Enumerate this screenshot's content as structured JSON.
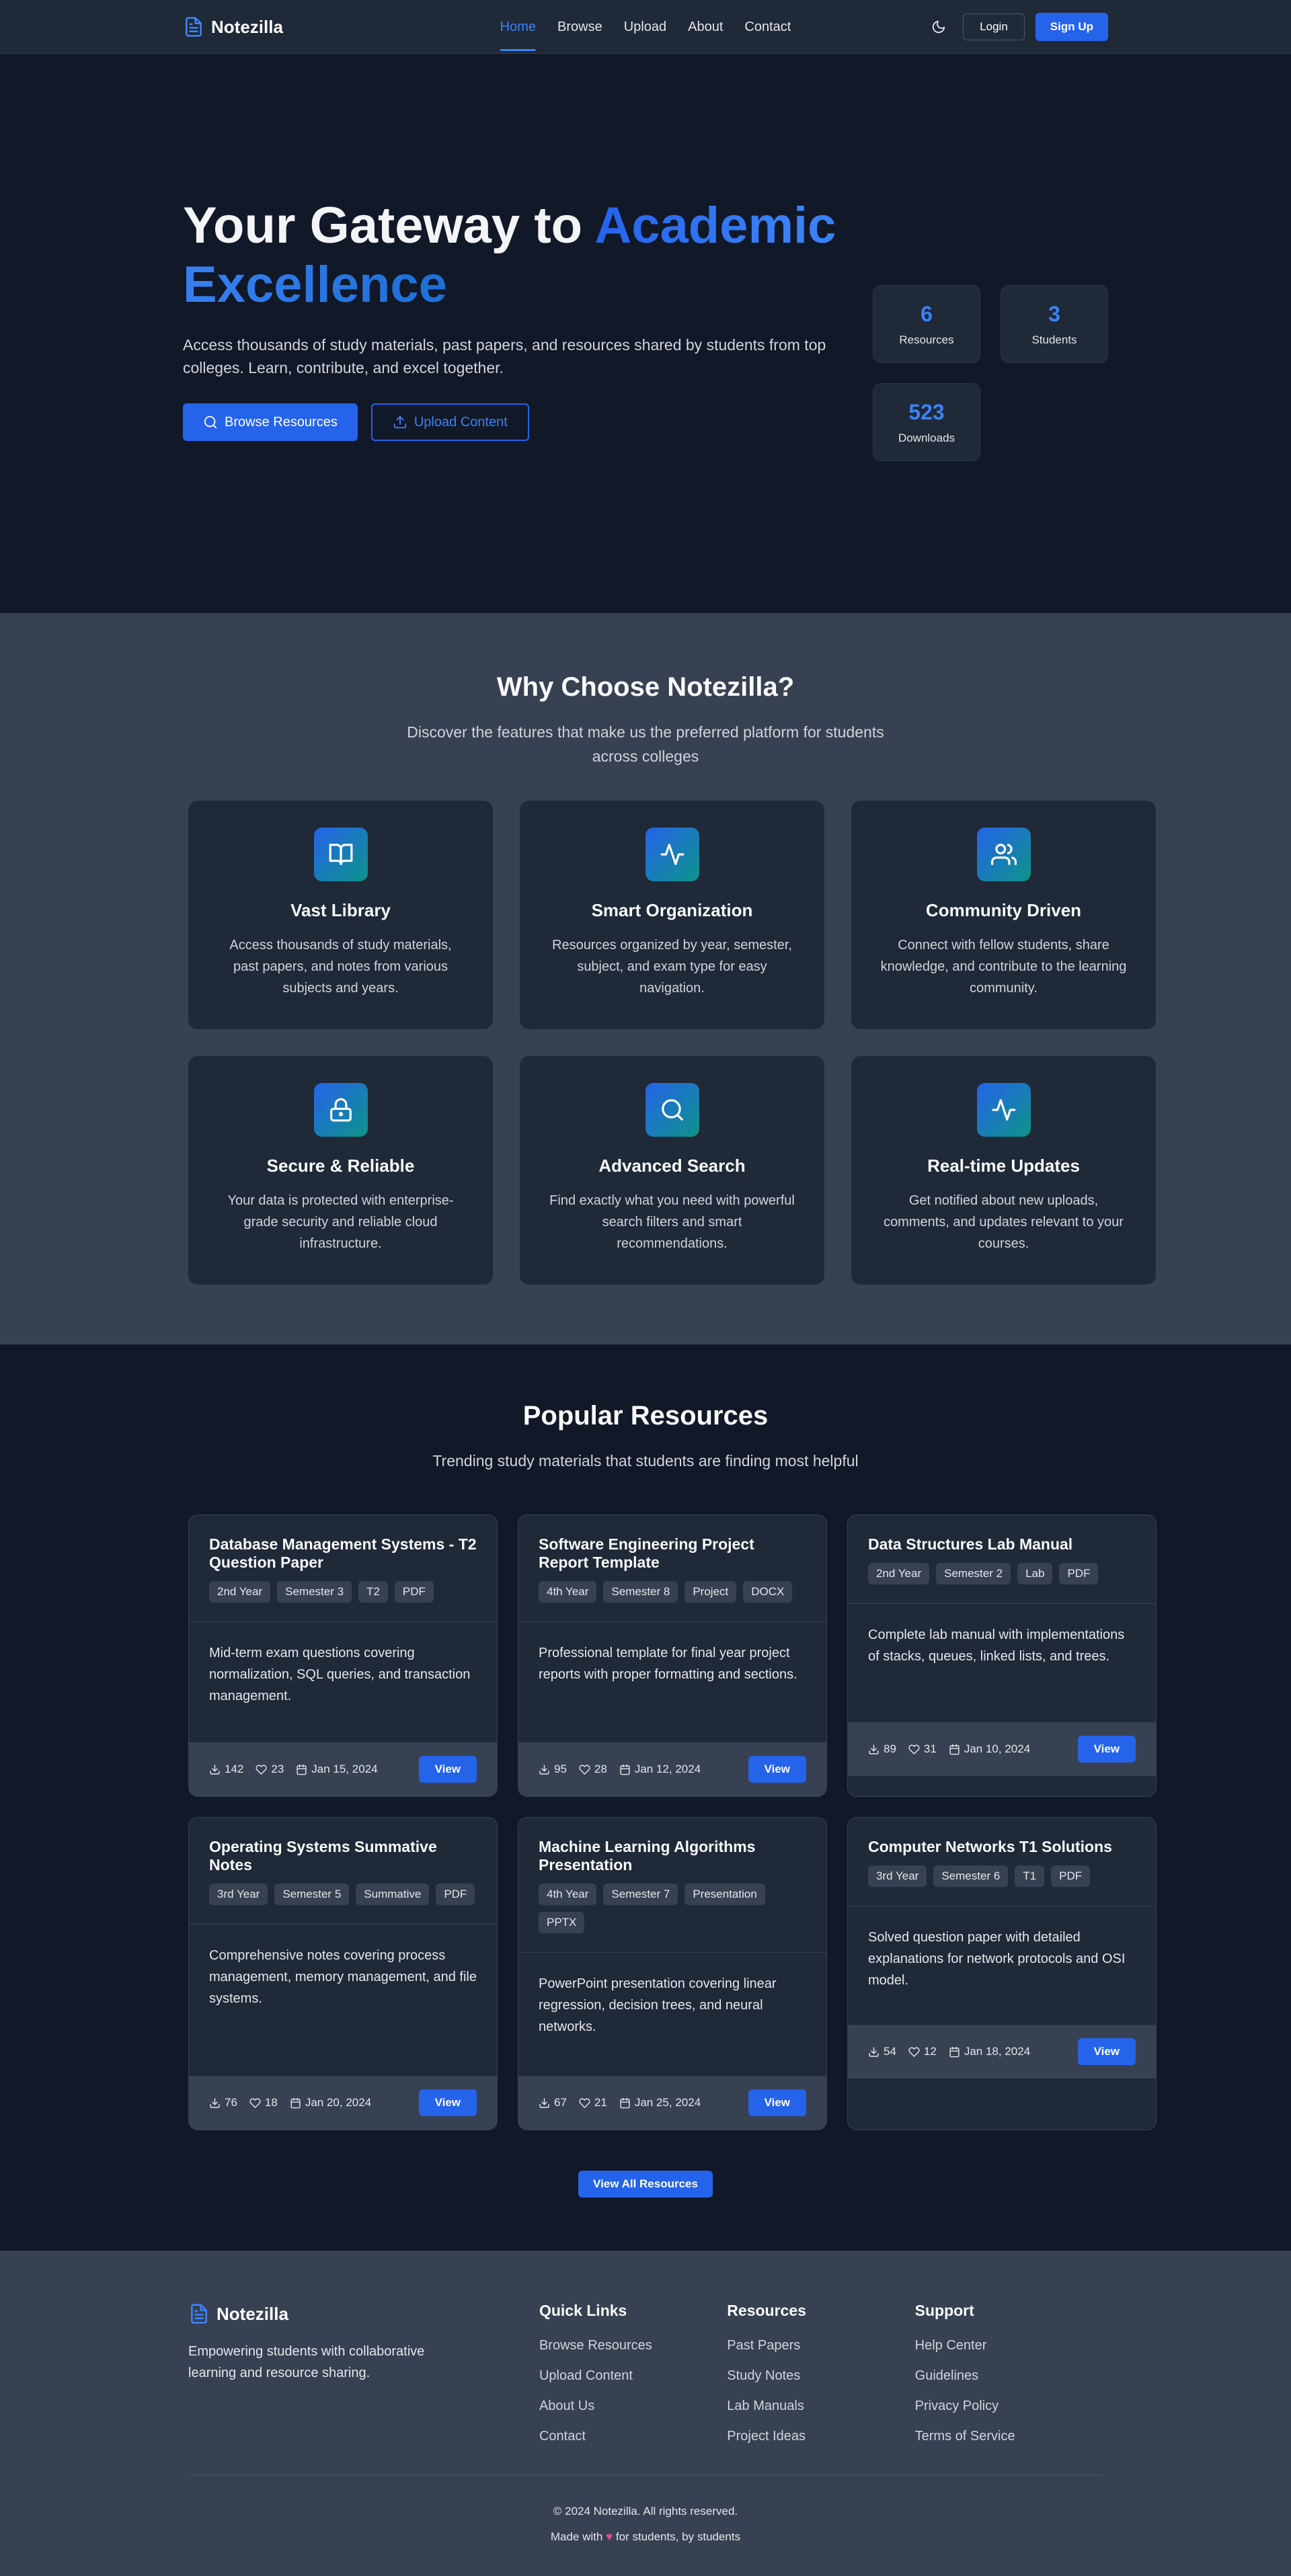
{
  "brand": {
    "name": "Notezilla"
  },
  "nav": {
    "links": [
      {
        "label": "Home",
        "active": true
      },
      {
        "label": "Browse"
      },
      {
        "label": "Upload"
      },
      {
        "label": "About"
      },
      {
        "label": "Contact"
      }
    ],
    "login": "Login",
    "signup": "Sign Up"
  },
  "hero": {
    "title_prefix": "Your Gateway to ",
    "title_accent": "Academic Excellence",
    "description": "Access thousands of study materials, past papers, and resources shared by students from top colleges. Learn, contribute, and excel together.",
    "browse_btn": "Browse Resources",
    "upload_btn": "Upload Content",
    "stats": [
      {
        "value": "6",
        "label": "Resources"
      },
      {
        "value": "3",
        "label": "Students"
      },
      {
        "value": "523",
        "label": "Downloads"
      }
    ]
  },
  "features": {
    "title": "Why Choose Notezilla?",
    "subtitle": "Discover the features that make us the preferred platform for students across colleges",
    "items": [
      {
        "icon": "book-open-icon",
        "title": "Vast Library",
        "desc": "Access thousands of study materials, past papers, and notes from various subjects and years."
      },
      {
        "icon": "activity-icon",
        "title": "Smart Organization",
        "desc": "Resources organized by year, semester, subject, and exam type for easy navigation."
      },
      {
        "icon": "users-icon",
        "title": "Community Driven",
        "desc": "Connect with fellow students, share knowledge, and contribute to the learning community."
      },
      {
        "icon": "lock-icon",
        "title": "Secure & Reliable",
        "desc": "Your data is protected with enterprise-grade security and reliable cloud infrastructure."
      },
      {
        "icon": "search-icon",
        "title": "Advanced Search",
        "desc": "Find exactly what you need with powerful search filters and smart recommendations."
      },
      {
        "icon": "activity-icon",
        "title": "Real-time Updates",
        "desc": "Get notified about new uploads, comments, and updates relevant to your courses."
      }
    ]
  },
  "resources": {
    "title": "Popular Resources",
    "subtitle": "Trending study materials that students are finding most helpful",
    "view_label": "View",
    "view_all": "View All Resources",
    "items": [
      {
        "title": "Database Management Systems - T2 Question Paper",
        "tags": [
          "2nd Year",
          "Semester 3",
          "T2",
          "PDF"
        ],
        "desc": "Mid-term exam questions covering normalization, SQL queries, and transaction management.",
        "downloads": "142",
        "likes": "23",
        "date": "Jan 15, 2024"
      },
      {
        "title": "Software Engineering Project Report Template",
        "tags": [
          "4th Year",
          "Semester 8",
          "Project",
          "DOCX"
        ],
        "desc": "Professional template for final year project reports with proper formatting and sections.",
        "downloads": "95",
        "likes": "28",
        "date": "Jan 12, 2024"
      },
      {
        "title": "Data Structures Lab Manual",
        "tags": [
          "2nd Year",
          "Semester 2",
          "Lab",
          "PDF"
        ],
        "desc": "Complete lab manual with implementations of stacks, queues, linked lists, and trees.",
        "downloads": "89",
        "likes": "31",
        "date": "Jan 10, 2024"
      },
      {
        "title": "Operating Systems Summative Notes",
        "tags": [
          "3rd Year",
          "Semester 5",
          "Summative",
          "PDF"
        ],
        "desc": "Comprehensive notes covering process management, memory management, and file systems.",
        "downloads": "76",
        "likes": "18",
        "date": "Jan 20, 2024"
      },
      {
        "title": "Machine Learning Algorithms Presentation",
        "tags": [
          "4th Year",
          "Semester 7",
          "Presentation",
          "PPTX"
        ],
        "desc": "PowerPoint presentation covering linear regression, decision trees, and neural networks.",
        "downloads": "67",
        "likes": "21",
        "date": "Jan 25, 2024"
      },
      {
        "title": "Computer Networks T1 Solutions",
        "tags": [
          "3rd Year",
          "Semester 6",
          "T1",
          "PDF"
        ],
        "desc": "Solved question paper with detailed explanations for network protocols and OSI model.",
        "downloads": "54",
        "likes": "12",
        "date": "Jan 18, 2024"
      }
    ]
  },
  "footer": {
    "tagline": "Empowering students with collaborative learning and resource sharing.",
    "columns": [
      {
        "title": "Quick Links",
        "links": [
          "Browse Resources",
          "Upload Content",
          "About Us",
          "Contact"
        ]
      },
      {
        "title": "Resources",
        "links": [
          "Past Papers",
          "Study Notes",
          "Lab Manuals",
          "Project Ideas"
        ]
      },
      {
        "title": "Support",
        "links": [
          "Help Center",
          "Guidelines",
          "Privacy Policy",
          "Terms of Service"
        ]
      }
    ],
    "copyright": "© 2024 Notezilla. All rights reserved.",
    "made_prefix": "Made with ",
    "made_heart": "♥",
    "made_suffix": " for students, by students"
  },
  "colors": {
    "accent": "#2563eb",
    "accent_light": "#3b82f6",
    "bg_dark": "#111827",
    "bg_card": "#1f2937",
    "bg_section": "#374151"
  }
}
